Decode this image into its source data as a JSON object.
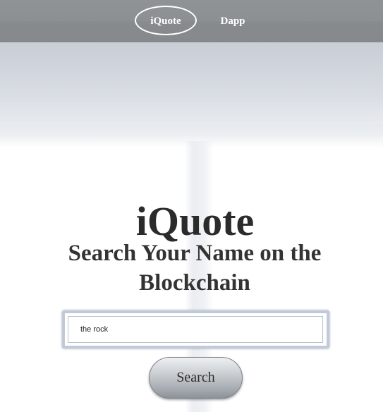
{
  "navbar": {
    "items": [
      {
        "label": "iQuote",
        "active": true
      },
      {
        "label": "Dapp",
        "active": false
      }
    ]
  },
  "hero": {
    "title": "iQuote",
    "subtitle": "Search Your Name on the Blockchain"
  },
  "search": {
    "value": "the rock",
    "button_label": "Search"
  },
  "colors": {
    "navbar": "#8c9093",
    "hero_top": "#c9ced6",
    "text": "#2b2b2b"
  }
}
